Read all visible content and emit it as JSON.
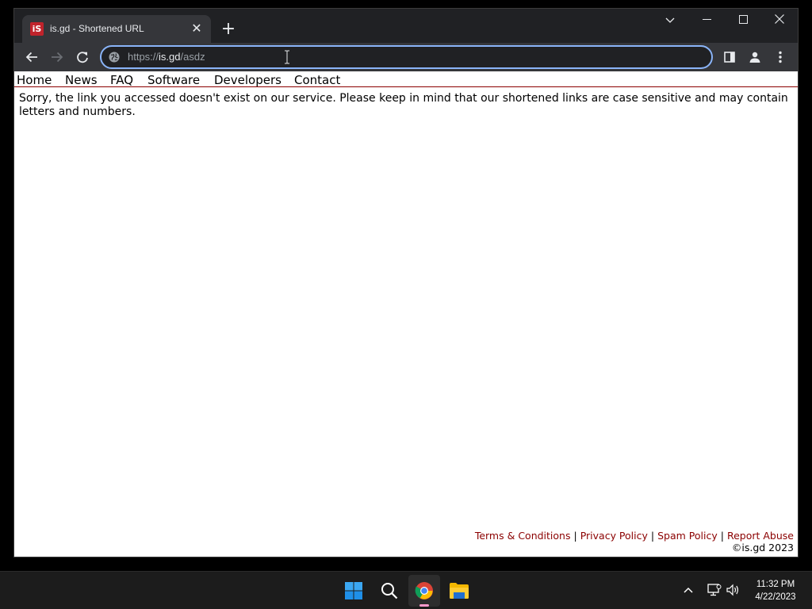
{
  "browser": {
    "tab": {
      "favicon_text": "iS",
      "title": "is.gd - Shortened URL"
    },
    "omnibox": {
      "url_prefix": "https://",
      "url_host": "is.gd",
      "url_path": "/asdz"
    }
  },
  "page": {
    "nav": [
      "Home",
      "News",
      "FAQ",
      "Software",
      "Developers",
      "Contact"
    ],
    "message": "Sorry, the link you accessed doesn't exist on our service. Please keep in mind that our shortened links are case sensitive and may contain letters and numbers.",
    "footer": {
      "links": [
        "Terms & Conditions",
        "Privacy Policy",
        "Spam Policy",
        "Report Abuse"
      ],
      "separator": "|",
      "copyright": "©is.gd 2023"
    }
  },
  "taskbar": {
    "clock_time": "11:32 PM",
    "clock_date": "4/22/2023"
  },
  "colors": {
    "link_red": "#8b0000",
    "omnibox_focus": "#8ab4f8",
    "chrome_indicator": "#ff99cc"
  }
}
